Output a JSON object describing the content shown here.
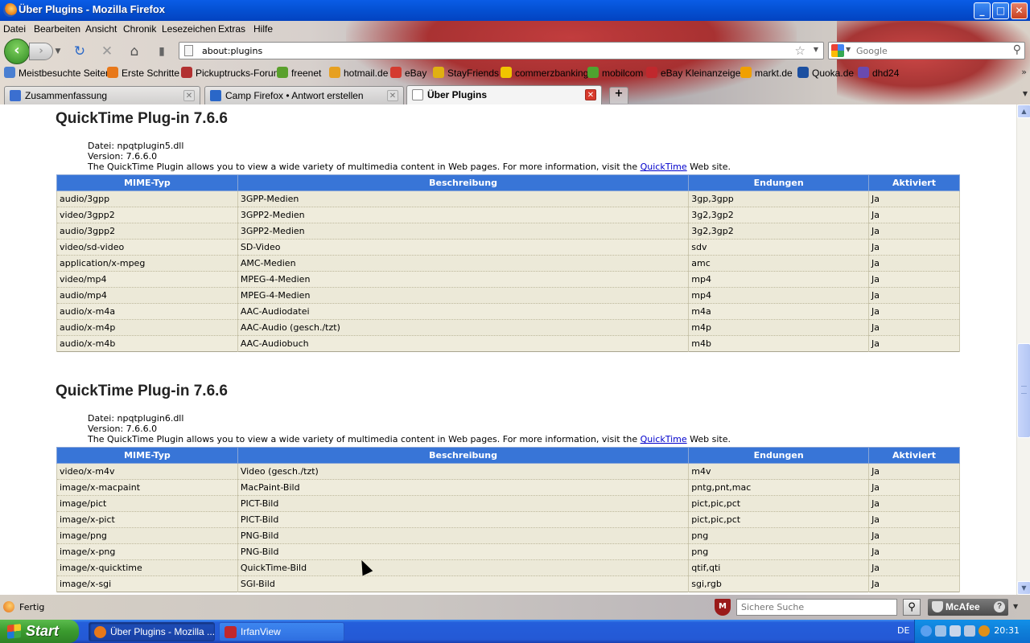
{
  "window": {
    "title": "Über Plugins - Mozilla Firefox",
    "minimize_label": "_",
    "maximize_label": "□",
    "close_label": "✕"
  },
  "menu": [
    "Datei",
    "Bearbeiten",
    "Ansicht",
    "Chronik",
    "Lesezeichen",
    "Extras",
    "Hilfe"
  ],
  "nav": {
    "url": "about:plugins",
    "search_placeholder": "Google"
  },
  "bookmarks": [
    {
      "label": "Meistbesuchte Seiten",
      "color": "#4a7fd1"
    },
    {
      "label": "Erste Schritte",
      "color": "#e8781a"
    },
    {
      "label": "Pickuptrucks-Forum",
      "color": "#b23030"
    },
    {
      "label": "freenet",
      "color": "#5aa02c"
    },
    {
      "label": "hotmail.de",
      "color": "#e7a020"
    },
    {
      "label": "eBay",
      "color": "#d43a2f"
    },
    {
      "label": "StayFriends",
      "color": "#e0b012"
    },
    {
      "label": "commerzbanking",
      "color": "#f1c400"
    },
    {
      "label": "mobilcom",
      "color": "#4fa32f"
    },
    {
      "label": "eBay Kleinanzeigen",
      "color": "#c0282d"
    },
    {
      "label": "markt.de",
      "color": "#f0a000"
    },
    {
      "label": "Quoka.de",
      "color": "#1c4fa0"
    },
    {
      "label": "dhd24",
      "color": "#6a4ab0"
    }
  ],
  "tabs": [
    {
      "label": "Zusammenfassung",
      "color": "#3b6fd0"
    },
    {
      "label": "Camp Firefox • Antwort erstellen",
      "color": "#2a67c8"
    },
    {
      "label": "Über Plugins",
      "color": "#ffffff"
    }
  ],
  "table_headers": [
    "MIME-Typ",
    "Beschreibung",
    "Endungen",
    "Aktiviert"
  ],
  "plugins": [
    {
      "name": "QuickTime Plug-in 7.6.6",
      "file": "Datei: npqtplugin5.dll",
      "version": "Version: 7.6.6.0",
      "desc_before": "The QuickTime Plugin allows you to view a wide variety of multimedia content in Web pages. For more information, visit the ",
      "desc_link": "QuickTime",
      "desc_after": " Web site.",
      "rows": [
        [
          "audio/3gpp",
          "3GPP-Medien",
          "3gp,3gpp",
          "Ja"
        ],
        [
          "video/3gpp2",
          "3GPP2-Medien",
          "3g2,3gp2",
          "Ja"
        ],
        [
          "audio/3gpp2",
          "3GPP2-Medien",
          "3g2,3gp2",
          "Ja"
        ],
        [
          "video/sd-video",
          "SD-Video",
          "sdv",
          "Ja"
        ],
        [
          "application/x-mpeg",
          "AMC-Medien",
          "amc",
          "Ja"
        ],
        [
          "video/mp4",
          "MPEG-4-Medien",
          "mp4",
          "Ja"
        ],
        [
          "audio/mp4",
          "MPEG-4-Medien",
          "mp4",
          "Ja"
        ],
        [
          "audio/x-m4a",
          "AAC-Audiodatei",
          "m4a",
          "Ja"
        ],
        [
          "audio/x-m4p",
          "AAC-Audio (gesch./tzt)",
          "m4p",
          "Ja"
        ],
        [
          "audio/x-m4b",
          "AAC-Audiobuch",
          "m4b",
          "Ja"
        ]
      ]
    },
    {
      "name": "QuickTime Plug-in 7.6.6",
      "file": "Datei: npqtplugin6.dll",
      "version": "Version: 7.6.6.0",
      "desc_before": "The QuickTime Plugin allows you to view a wide variety of multimedia content in Web pages. For more information, visit the ",
      "desc_link": "QuickTime",
      "desc_after": " Web site.",
      "rows": [
        [
          "video/x-m4v",
          "Video (gesch./tzt)",
          "m4v",
          "Ja"
        ],
        [
          "image/x-macpaint",
          "MacPaint-Bild",
          "pntg,pnt,mac",
          "Ja"
        ],
        [
          "image/pict",
          "PICT-Bild",
          "pict,pic,pct",
          "Ja"
        ],
        [
          "image/x-pict",
          "PICT-Bild",
          "pict,pic,pct",
          "Ja"
        ],
        [
          "image/png",
          "PNG-Bild",
          "png",
          "Ja"
        ],
        [
          "image/x-png",
          "PNG-Bild",
          "png",
          "Ja"
        ],
        [
          "image/x-quicktime",
          "QuickTime-Bild",
          "qtif,qti",
          "Ja"
        ],
        [
          "image/x-sgi",
          "SGI-Bild",
          "sgi,rgb",
          "Ja"
        ]
      ]
    }
  ],
  "status": {
    "text": "Fertig",
    "safe_search_placeholder": "Sichere Suche",
    "mcafee": "McAfee",
    "help": "?"
  },
  "taskbar": {
    "start": "Start",
    "tasks": [
      {
        "label": "Über Plugins - Mozilla ...",
        "color": "#e8781a",
        "active": true
      },
      {
        "label": "IrfanView",
        "color": "#c0282d",
        "active": false
      }
    ],
    "lang": "DE",
    "clock": "20:31"
  }
}
